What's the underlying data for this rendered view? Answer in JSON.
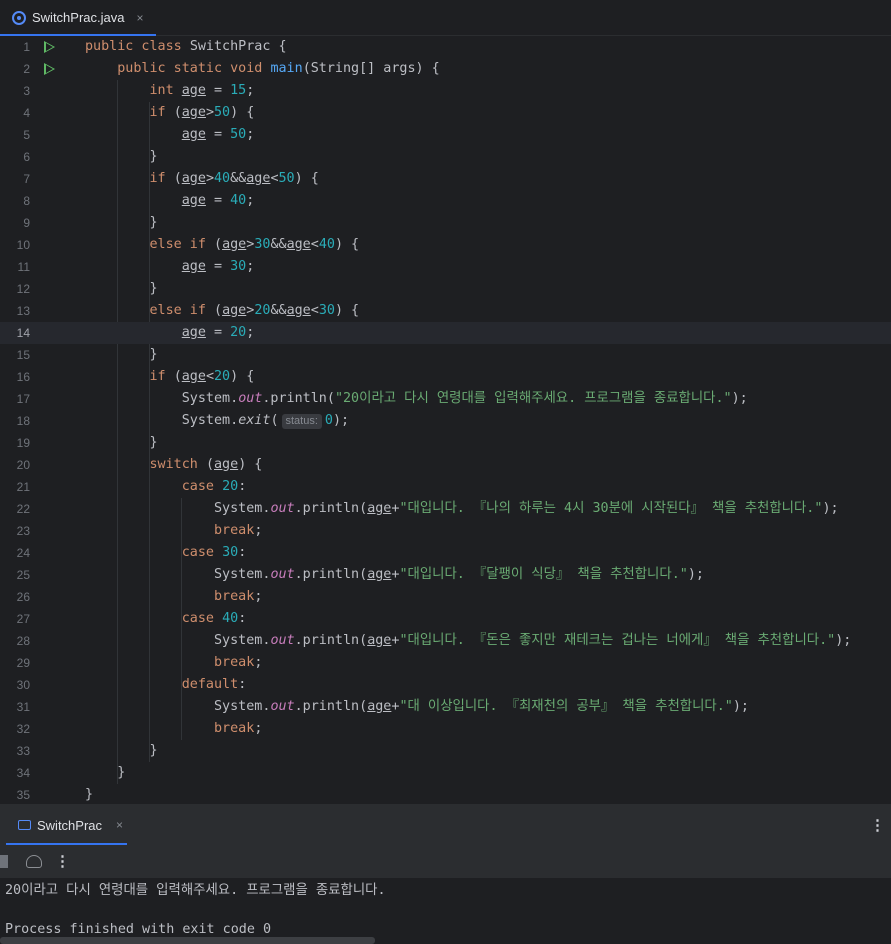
{
  "tab": {
    "filename": "SwitchPrac.java",
    "close": "×"
  },
  "editor": {
    "current_line": 14,
    "lines": [
      {
        "n": "1",
        "tokens": [
          [
            "kw",
            "public class "
          ],
          [
            "t",
            "SwitchPrac "
          ],
          [
            "t",
            "{"
          ]
        ],
        "run": true
      },
      {
        "n": "2",
        "tokens": [
          [
            "t",
            "    "
          ],
          [
            "kw",
            "public static void "
          ],
          [
            "mfn",
            "main"
          ],
          [
            "t",
            "(String[] args) {"
          ]
        ],
        "run": true
      },
      {
        "n": "3",
        "tokens": [
          [
            "t",
            "        "
          ],
          [
            "kw",
            "int "
          ],
          [
            "var",
            "age"
          ],
          [
            "t",
            " = "
          ],
          [
            "num",
            "15"
          ],
          [
            "t",
            ";"
          ]
        ]
      },
      {
        "n": "4",
        "tokens": [
          [
            "t",
            "        "
          ],
          [
            "kw",
            "if "
          ],
          [
            "t",
            "("
          ],
          [
            "var",
            "age"
          ],
          [
            "t",
            ">"
          ],
          [
            "num",
            "50"
          ],
          [
            "t",
            ") {"
          ]
        ]
      },
      {
        "n": "5",
        "tokens": [
          [
            "t",
            "            "
          ],
          [
            "var",
            "age"
          ],
          [
            "t",
            " = "
          ],
          [
            "num",
            "50"
          ],
          [
            "t",
            ";"
          ]
        ]
      },
      {
        "n": "6",
        "tokens": [
          [
            "t",
            "        }"
          ]
        ]
      },
      {
        "n": "7",
        "tokens": [
          [
            "t",
            "        "
          ],
          [
            "kw",
            "if "
          ],
          [
            "t",
            "("
          ],
          [
            "var",
            "age"
          ],
          [
            "t",
            ">"
          ],
          [
            "num",
            "40"
          ],
          [
            "t",
            "&&"
          ],
          [
            "var",
            "age"
          ],
          [
            "t",
            "<"
          ],
          [
            "num",
            "50"
          ],
          [
            "t",
            ") {"
          ]
        ]
      },
      {
        "n": "8",
        "tokens": [
          [
            "t",
            "            "
          ],
          [
            "var",
            "age"
          ],
          [
            "t",
            " = "
          ],
          [
            "num",
            "40"
          ],
          [
            "t",
            ";"
          ]
        ]
      },
      {
        "n": "9",
        "tokens": [
          [
            "t",
            "        }"
          ]
        ]
      },
      {
        "n": "10",
        "tokens": [
          [
            "t",
            "        "
          ],
          [
            "kw",
            "else if "
          ],
          [
            "t",
            "("
          ],
          [
            "var",
            "age"
          ],
          [
            "t",
            ">"
          ],
          [
            "num",
            "30"
          ],
          [
            "t",
            "&&"
          ],
          [
            "var",
            "age"
          ],
          [
            "t",
            "<"
          ],
          [
            "num",
            "40"
          ],
          [
            "t",
            ") {"
          ]
        ]
      },
      {
        "n": "11",
        "tokens": [
          [
            "t",
            "            "
          ],
          [
            "var",
            "age"
          ],
          [
            "t",
            " = "
          ],
          [
            "num",
            "30"
          ],
          [
            "t",
            ";"
          ]
        ]
      },
      {
        "n": "12",
        "tokens": [
          [
            "t",
            "        }"
          ]
        ]
      },
      {
        "n": "13",
        "tokens": [
          [
            "t",
            "        "
          ],
          [
            "kw",
            "else if "
          ],
          [
            "t",
            "("
          ],
          [
            "var",
            "age"
          ],
          [
            "t",
            ">"
          ],
          [
            "num",
            "20"
          ],
          [
            "t",
            "&&"
          ],
          [
            "var",
            "age"
          ],
          [
            "t",
            "<"
          ],
          [
            "num",
            "30"
          ],
          [
            "t",
            ") {"
          ]
        ]
      },
      {
        "n": "14",
        "tokens": [
          [
            "t",
            "            "
          ],
          [
            "var",
            "age"
          ],
          [
            "t",
            " = "
          ],
          [
            "num",
            "20"
          ],
          [
            "t",
            ";"
          ]
        ]
      },
      {
        "n": "15",
        "tokens": [
          [
            "t",
            "        }"
          ]
        ]
      },
      {
        "n": "16",
        "tokens": [
          [
            "t",
            "        "
          ],
          [
            "kw",
            "if "
          ],
          [
            "t",
            "("
          ],
          [
            "var",
            "age"
          ],
          [
            "t",
            "<"
          ],
          [
            "num",
            "20"
          ],
          [
            "t",
            ") {"
          ]
        ]
      },
      {
        "n": "17",
        "tokens": [
          [
            "t",
            "            System."
          ],
          [
            "fld",
            "out"
          ],
          [
            "t",
            ".println("
          ],
          [
            "str",
            "\"20이라고 다시 연령대를 입력해주세요. 프로그램을 종료합니다.\""
          ],
          [
            "t",
            ");"
          ]
        ]
      },
      {
        "n": "18",
        "tokens": [
          [
            "t",
            "            System."
          ],
          [
            "ital",
            "exit"
          ],
          [
            "t",
            "("
          ],
          [
            "hint",
            "status:"
          ],
          [
            "num",
            "0"
          ],
          [
            "t",
            ");"
          ]
        ]
      },
      {
        "n": "19",
        "tokens": [
          [
            "t",
            "        }"
          ]
        ]
      },
      {
        "n": "20",
        "tokens": [
          [
            "t",
            "        "
          ],
          [
            "kw",
            "switch "
          ],
          [
            "t",
            "("
          ],
          [
            "var",
            "age"
          ],
          [
            "t",
            ") {"
          ]
        ]
      },
      {
        "n": "21",
        "tokens": [
          [
            "t",
            "            "
          ],
          [
            "kw",
            "case "
          ],
          [
            "num",
            "20"
          ],
          [
            "t",
            ":"
          ]
        ]
      },
      {
        "n": "22",
        "tokens": [
          [
            "t",
            "                System."
          ],
          [
            "fld",
            "out"
          ],
          [
            "t",
            ".println("
          ],
          [
            "var",
            "age"
          ],
          [
            "t",
            "+"
          ],
          [
            "str",
            "\"대입니다. 『나의 하루는 4시 30분에 시작된다』 책을 추천합니다.\""
          ],
          [
            "t",
            ");"
          ]
        ]
      },
      {
        "n": "23",
        "tokens": [
          [
            "t",
            "                "
          ],
          [
            "kw",
            "break"
          ],
          [
            "t",
            ";"
          ]
        ]
      },
      {
        "n": "24",
        "tokens": [
          [
            "t",
            "            "
          ],
          [
            "kw",
            "case "
          ],
          [
            "num",
            "30"
          ],
          [
            "t",
            ":"
          ]
        ]
      },
      {
        "n": "25",
        "tokens": [
          [
            "t",
            "                System."
          ],
          [
            "fld",
            "out"
          ],
          [
            "t",
            ".println("
          ],
          [
            "var",
            "age"
          ],
          [
            "t",
            "+"
          ],
          [
            "str",
            "\"대입니다. 『달팽이 식당』 책을 추천합니다.\""
          ],
          [
            "t",
            ");"
          ]
        ]
      },
      {
        "n": "26",
        "tokens": [
          [
            "t",
            "                "
          ],
          [
            "kw",
            "break"
          ],
          [
            "t",
            ";"
          ]
        ]
      },
      {
        "n": "27",
        "tokens": [
          [
            "t",
            "            "
          ],
          [
            "kw",
            "case "
          ],
          [
            "num",
            "40"
          ],
          [
            "t",
            ":"
          ]
        ]
      },
      {
        "n": "28",
        "tokens": [
          [
            "t",
            "                System."
          ],
          [
            "fld",
            "out"
          ],
          [
            "t",
            ".println("
          ],
          [
            "var",
            "age"
          ],
          [
            "t",
            "+"
          ],
          [
            "str",
            "\"대입니다. 『돈은 좋지만 재테크는 겁나는 너에게』 책을 추천합니다.\""
          ],
          [
            "t",
            ");"
          ]
        ]
      },
      {
        "n": "29",
        "tokens": [
          [
            "t",
            "                "
          ],
          [
            "kw",
            "break"
          ],
          [
            "t",
            ";"
          ]
        ]
      },
      {
        "n": "30",
        "tokens": [
          [
            "t",
            "            "
          ],
          [
            "kw",
            "default"
          ],
          [
            "t",
            ":"
          ]
        ]
      },
      {
        "n": "31",
        "tokens": [
          [
            "t",
            "                System."
          ],
          [
            "fld",
            "out"
          ],
          [
            "t",
            ".println("
          ],
          [
            "var",
            "age"
          ],
          [
            "t",
            "+"
          ],
          [
            "str",
            "\"대 이상입니다. 『최재천의 공부』 책을 추천합니다.\""
          ],
          [
            "t",
            ");"
          ]
        ]
      },
      {
        "n": "32",
        "tokens": [
          [
            "t",
            "                "
          ],
          [
            "kw",
            "break"
          ],
          [
            "t",
            ";"
          ]
        ]
      },
      {
        "n": "33",
        "tokens": [
          [
            "t",
            "        }"
          ]
        ]
      },
      {
        "n": "34",
        "tokens": [
          [
            "t",
            "    }"
          ]
        ]
      },
      {
        "n": "35",
        "tokens": [
          [
            "t",
            "}"
          ]
        ]
      }
    ]
  },
  "run_panel": {
    "tab_label": "SwitchPrac",
    "close": "×",
    "more": "⋮",
    "output": [
      "20이라고 다시 연령대를 입력해주세요. 프로그램을 종료합니다.",
      "",
      "Process finished with exit code 0"
    ]
  },
  "colors": {
    "background": "#1e1f22",
    "keyword": "#cf8e6d",
    "number": "#2aacb8",
    "string": "#6aab73",
    "field": "#c77dbb",
    "method": "#56a8f5",
    "accent": "#3574f0",
    "run_gutter": "#5fb865"
  }
}
